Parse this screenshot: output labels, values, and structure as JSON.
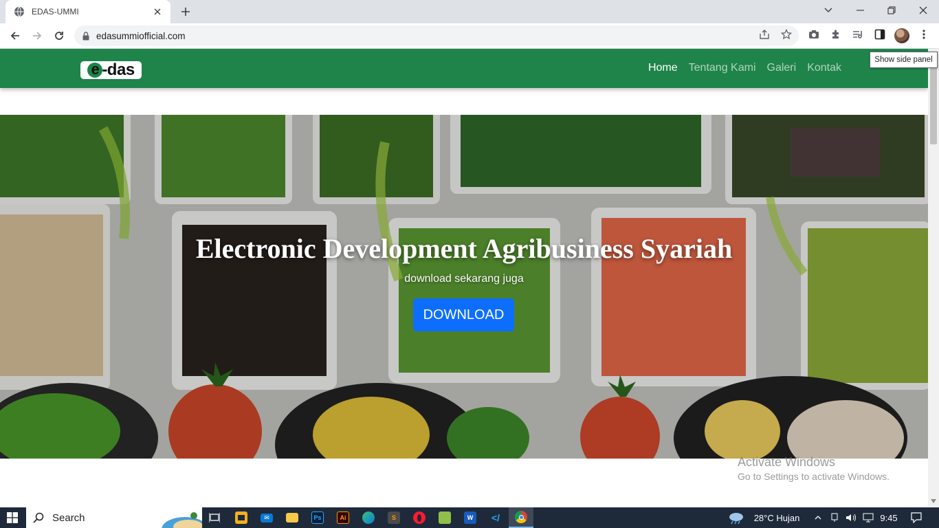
{
  "browser": {
    "tab_title": "EDAS-UMMI",
    "url": "edasummiofficial.com",
    "tooltip": "Show side panel"
  },
  "site": {
    "logo_text": "e-das",
    "nav": [
      {
        "label": "Home",
        "active": true
      },
      {
        "label": "Tentang Kami",
        "active": false
      },
      {
        "label": "Galeri",
        "active": false
      },
      {
        "label": "Kontak",
        "active": false
      }
    ],
    "hero": {
      "title": "Electronic Development Agribusiness Syariah",
      "subtitle": "download sekarang juga",
      "button_label": "DOWNLOAD"
    },
    "colors": {
      "navbar": "#1e8449",
      "button": "#0d6efd"
    }
  },
  "watermark": {
    "line1": "Activate Windows",
    "line2": "Go to Settings to activate Windows."
  },
  "taskbar": {
    "search_label": "Search",
    "weather": "28°C  Hujan",
    "time": "9:45",
    "apps": [
      "task-view",
      "store",
      "mail",
      "file-explorer",
      "photoshop",
      "illustrator",
      "edge",
      "sublime-text",
      "opera",
      "notepad-plus",
      "word",
      "vscode",
      "chrome"
    ]
  }
}
